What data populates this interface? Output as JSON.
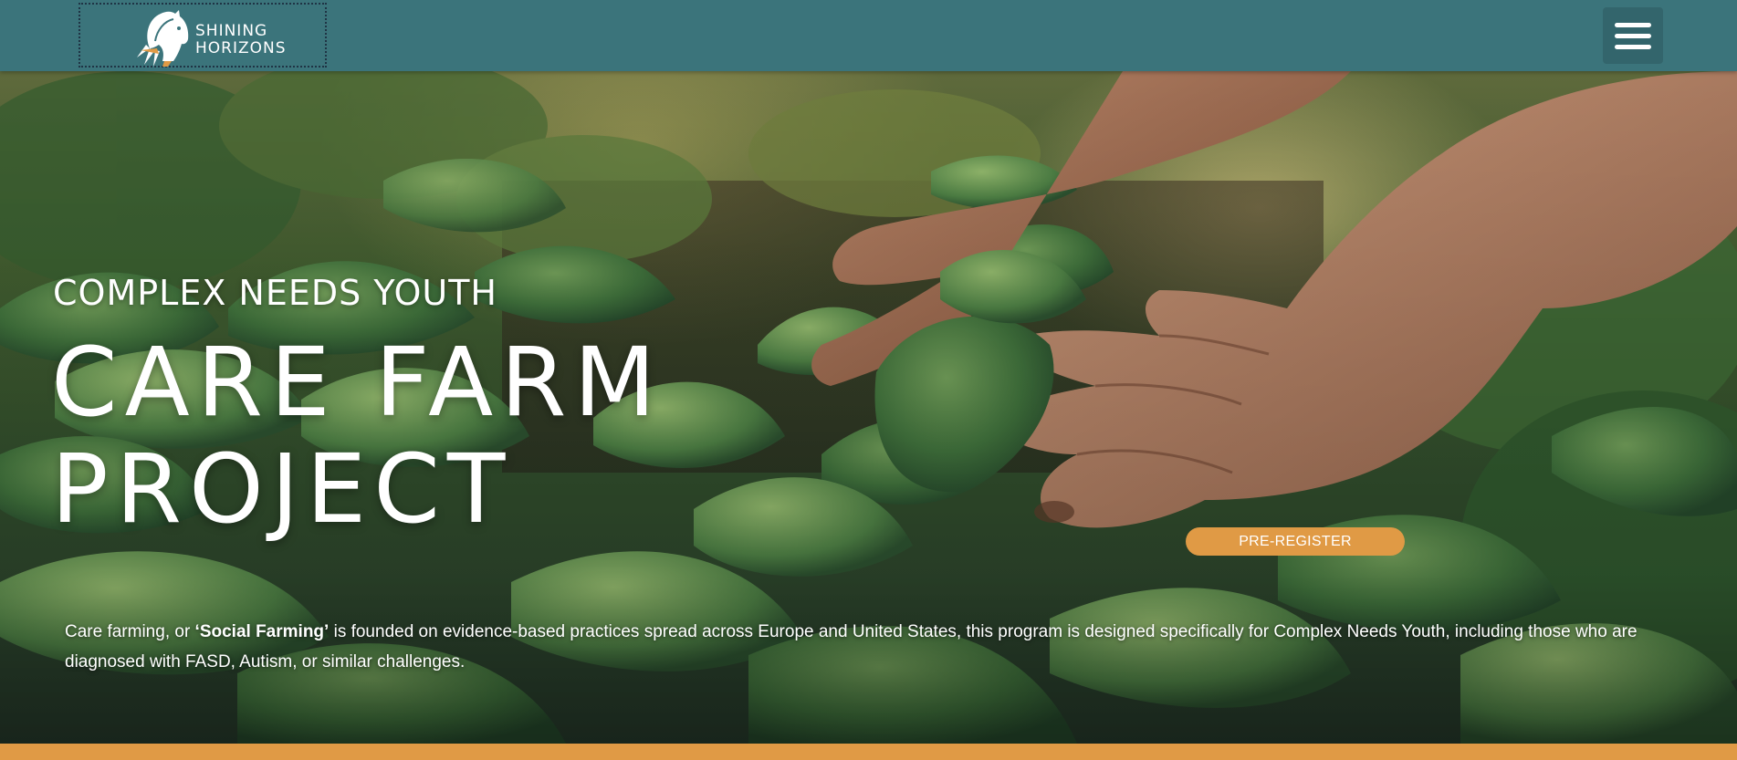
{
  "brand": {
    "line1": "SHINING",
    "line2": "HORIZONS",
    "logo_icon": "horse-head-sunrise-icon"
  },
  "header": {
    "menu_icon": "hamburger-menu-icon",
    "color": "#3b747b"
  },
  "hero": {
    "eyebrow": "COMPLEX NEEDS YOUTH",
    "headline_line1": "CARE FARM",
    "headline_line2": "PROJECT",
    "cta_label": "PRE-REGISTER",
    "description_pre": "Care farming, or ",
    "description_bold": "‘Social Farming’",
    "description_post": " is founded on evidence-based practices spread across Europe and United States, this program is designed specifically for Complex Needs Youth, including those who are diagnosed with FASD, Autism, or similar challenges.",
    "accent_color": "#e09a45"
  }
}
